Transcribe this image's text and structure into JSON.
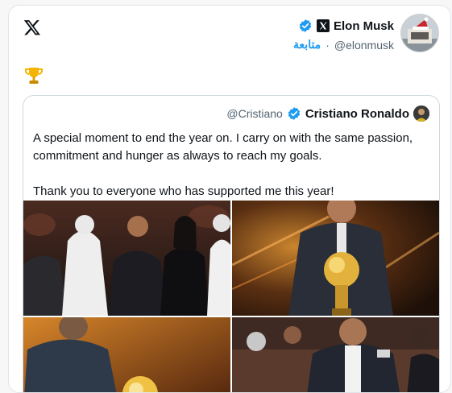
{
  "author": {
    "name": "Elon Musk",
    "handle": "@elonmusk",
    "follow_label": "متابعة",
    "separator": "·"
  },
  "icons": {
    "logo": "x-logo-icon",
    "verified": "verified-badge-icon",
    "affiliate": "x-affiliate-badge-icon",
    "trophy": "trophy-emoji-icon"
  },
  "post": {
    "emoji": "🏆"
  },
  "quoted": {
    "name": "Cristiano Ronaldo",
    "handle": "@Cristiano",
    "paragraphs": [
      "A special moment to end the year on. I carry on with the same passion, commitment and hunger as always to reach my goals.",
      "Thank you to everyone who has supported me this year!"
    ]
  },
  "colors": {
    "accent": "#1d9bf0",
    "verified": "#1d9bf0",
    "text": "#0f1419",
    "muted": "#536471"
  }
}
